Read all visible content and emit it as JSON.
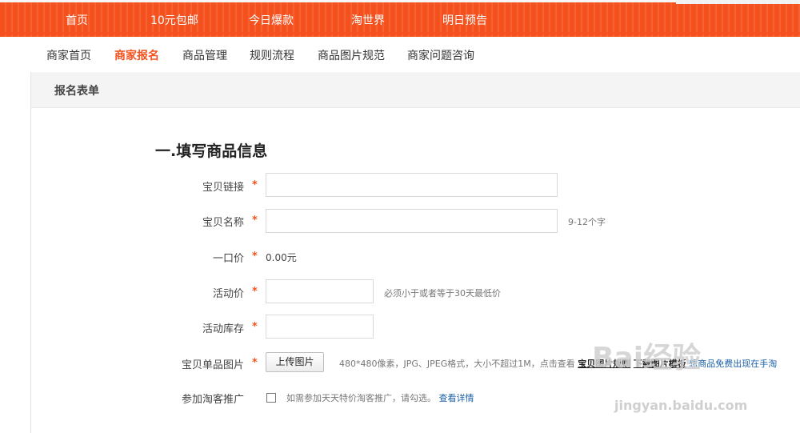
{
  "top_nav": {
    "items": [
      "首页",
      "10元包邮",
      "今日爆款",
      "淘世界",
      "明日预告"
    ]
  },
  "sub_nav": {
    "items": [
      "商家首页",
      "商家报名",
      "商品管理",
      "规则流程",
      "商品图片规范",
      "商家问题咨询"
    ],
    "active": "商家报名"
  },
  "panel": {
    "title": "报名表单"
  },
  "form": {
    "section_title": "一.填写商品信息",
    "required_mark": "*",
    "link": {
      "label": "宝贝链接",
      "value": ""
    },
    "name": {
      "label": "宝贝名称",
      "value": "",
      "hint": "9-12个字"
    },
    "price": {
      "label": "一口价",
      "value": "0.00元"
    },
    "promo_price": {
      "label": "活动价",
      "value": "",
      "hint": "必须小于或者等于30天最低价"
    },
    "stock": {
      "label": "活动库存",
      "value": ""
    },
    "image": {
      "label": "宝贝单品图片",
      "upload_label": "上传图片",
      "hint": "480*480像素，JPG、JPEG格式，大小不超过1M，点击查看",
      "rule_link": "宝贝图片规则",
      "template_link": "下载图片模板",
      "free_text": "想商品免费出现在手淘"
    },
    "taoke": {
      "label": "参加淘客推广",
      "checked": false,
      "hint": "如需参加天天特价淘客推广，请勾选。",
      "details_link": "查看详情"
    }
  },
  "watermark": {
    "brand": "Bai经验",
    "url": "jingyan.baidu.com"
  },
  "colors": {
    "brand_orange": "#f4511e",
    "link_blue": "#1a5fa8"
  }
}
